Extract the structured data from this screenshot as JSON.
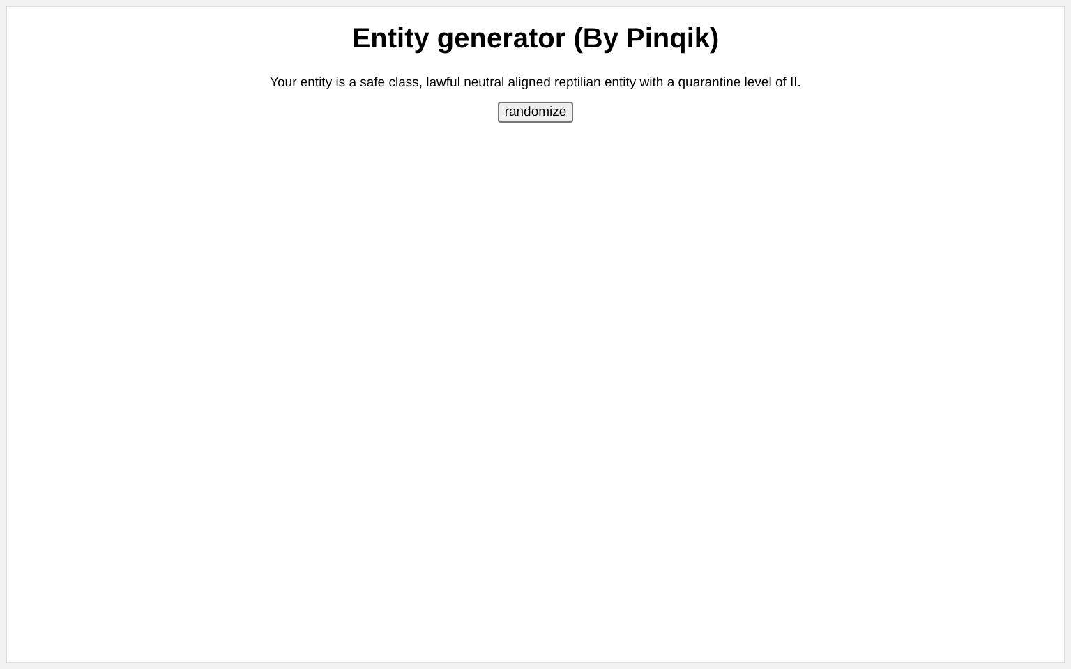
{
  "page": {
    "title": "Entity generator (By Pinqik)",
    "description": "Your entity is a safe class, lawful neutral aligned reptilian entity with a quarantine level of II.",
    "button": "randomize"
  }
}
